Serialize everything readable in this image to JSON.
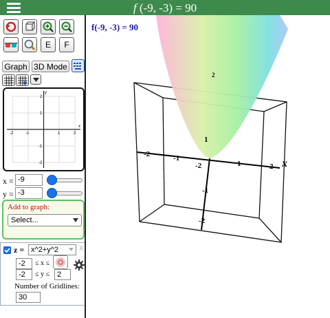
{
  "header": {
    "title": "f(-9, -3) = 90",
    "title_func": "f",
    "title_args": " (-9, -3) = 90"
  },
  "toolbar": {
    "row1": [
      "reset-view-icon",
      "rotate-cube-icon",
      "zoom-in-icon",
      "zoom-out-icon"
    ],
    "row2": [
      "3d-glasses-icon",
      "zoom-box-icon"
    ],
    "e_label": "E",
    "f_label": "F"
  },
  "mode_buttons": {
    "graph": "Graph",
    "mode3d": "3D Mode"
  },
  "mini_graph": {
    "x_ticks": [
      "-2",
      "-1",
      "1",
      "2"
    ],
    "y_ticks": [
      "2",
      "1",
      "-1",
      "-2"
    ],
    "x_axis": "x",
    "y_axis": "y"
  },
  "variables": {
    "x_label": "x =",
    "x_value": "-9",
    "y_label": "y =",
    "y_value": "-3"
  },
  "add_to_graph": {
    "label": "Add to graph:",
    "select": "Select..."
  },
  "function": {
    "checked": true,
    "name": "z =",
    "expr": "x^2+y^2",
    "remove": "X",
    "xmin": "-2",
    "x_range_label": "≤ x ≤",
    "ymin": "-2",
    "y_range_label": "≤ y ≤",
    "ymax": "2",
    "gridlines_label": "Number of Gridlines:",
    "gridlines": "30"
  },
  "plot": {
    "eval_text": "f(-9, -3) = 90",
    "x_ticks": [
      "-2",
      "-1",
      "1",
      "2"
    ],
    "y_ticks": [
      "1",
      "-1",
      "-2"
    ],
    "origin": "-2",
    "x_axis": "x",
    "z_tick": "2",
    "surface_colors": [
      "#ffb3d9",
      "#a8f0a0",
      "#7ee0e0",
      "#c0a8f8"
    ]
  }
}
